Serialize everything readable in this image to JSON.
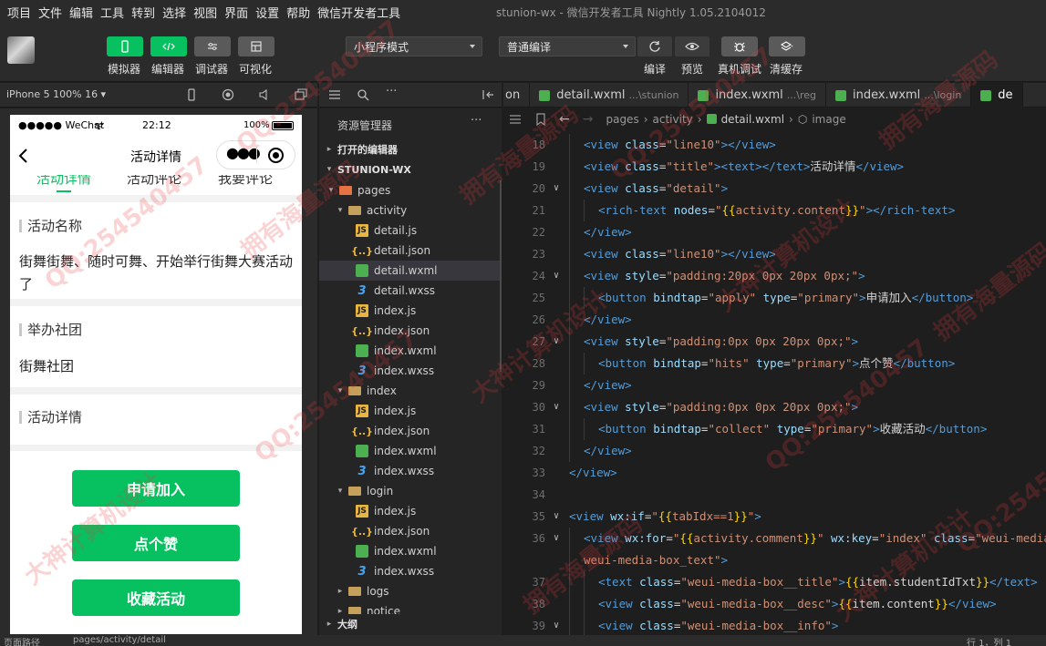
{
  "menu": [
    "项目",
    "文件",
    "编辑",
    "工具",
    "转到",
    "选择",
    "视图",
    "界面",
    "设置",
    "帮助",
    "微信开发者工具"
  ],
  "window_title": "stunion-wx - 微信开发者工具 Nightly 1.05.2104012",
  "toolbar": {
    "simulator": "模拟器",
    "editor": "编辑器",
    "debugger": "调试器",
    "visual": "可视化",
    "mode_select": "小程序模式",
    "compile_select": "普通编译",
    "compile": "编译",
    "preview": "预览",
    "remote_debug": "真机调试",
    "clear_cache": "清缓存"
  },
  "simulator_header": {
    "device": "iPhone 5 100% 16 ▾"
  },
  "phone": {
    "carrier": "●●●●● WeChat",
    "time": "22:12",
    "battery": "100%",
    "nav_title": "活动详情",
    "tabs": [
      "活动详情",
      "活动评论",
      "我要评论"
    ],
    "section1_title": "活动名称",
    "section1_text": "街舞街舞、随时可舞、开始举行街舞大赛活动了",
    "section2_title": "举办社团",
    "section2_text": "街舞社团",
    "section3_title": "活动详情",
    "buttons": [
      "申请加入",
      "点个赞",
      "收藏活动"
    ]
  },
  "explorer": {
    "title": "资源管理器",
    "open_editors": "打开的编辑器",
    "project": "STUNION-WX",
    "outline": "大纲",
    "tree": [
      {
        "label": "pages",
        "type": "folder-red",
        "arrow": "▾",
        "level": 1
      },
      {
        "label": "activity",
        "type": "folder",
        "arrow": "▾",
        "level": 2
      },
      {
        "label": "detail.js",
        "type": "js",
        "arrow": "",
        "level": 3
      },
      {
        "label": "detail.json",
        "type": "json",
        "arrow": "",
        "level": 3
      },
      {
        "label": "detail.wxml",
        "type": "wxml",
        "arrow": "",
        "level": 3,
        "selected": true
      },
      {
        "label": "detail.wxss",
        "type": "wxss",
        "arrow": "",
        "level": 3
      },
      {
        "label": "index.js",
        "type": "js",
        "arrow": "",
        "level": 3
      },
      {
        "label": "index.json",
        "type": "json",
        "arrow": "",
        "level": 3
      },
      {
        "label": "index.wxml",
        "type": "wxml",
        "arrow": "",
        "level": 3
      },
      {
        "label": "index.wxss",
        "type": "wxss",
        "arrow": "",
        "level": 3
      },
      {
        "label": "index",
        "type": "folder",
        "arrow": "▾",
        "level": 2
      },
      {
        "label": "index.js",
        "type": "js",
        "arrow": "",
        "level": 3
      },
      {
        "label": "index.json",
        "type": "json",
        "arrow": "",
        "level": 3
      },
      {
        "label": "index.wxml",
        "type": "wxml",
        "arrow": "",
        "level": 3
      },
      {
        "label": "index.wxss",
        "type": "wxss",
        "arrow": "",
        "level": 3
      },
      {
        "label": "login",
        "type": "folder",
        "arrow": "▾",
        "level": 2
      },
      {
        "label": "index.js",
        "type": "js",
        "arrow": "",
        "level": 3
      },
      {
        "label": "index.json",
        "type": "json",
        "arrow": "",
        "level": 3
      },
      {
        "label": "index.wxml",
        "type": "wxml",
        "arrow": "",
        "level": 3
      },
      {
        "label": "index.wxss",
        "type": "wxss",
        "arrow": "",
        "level": 3
      },
      {
        "label": "logs",
        "type": "folder",
        "arrow": "▸",
        "level": 2
      },
      {
        "label": "notice",
        "type": "folder",
        "arrow": "▸",
        "level": 2
      }
    ]
  },
  "editor_tabs": [
    {
      "name": "on",
      "path": "",
      "icon": false
    },
    {
      "name": "detail.wxml",
      "path": "...\\stunion",
      "icon": true
    },
    {
      "name": "index.wxml",
      "path": "...\\reg",
      "icon": true
    },
    {
      "name": "index.wxml",
      "path": "...\\login",
      "icon": true
    },
    {
      "name": "de",
      "path": "",
      "icon": true,
      "active": true
    }
  ],
  "breadcrumb": [
    "pages",
    "activity",
    "detail.wxml",
    "image"
  ],
  "code_lines": [
    {
      "n": "18",
      "fold": "",
      "indent": 1,
      "html": "<span class='t'>&lt;view</span> <span class='a'>class</span><span class='x'>=</span><span class='s'>\"line10\"</span><span class='t'>&gt;&lt;/view&gt;</span>"
    },
    {
      "n": "19",
      "fold": "",
      "indent": 1,
      "html": "<span class='t'>&lt;view</span> <span class='a'>class</span><span class='x'>=</span><span class='s'>\"title\"</span><span class='t'>&gt;&lt;text&gt;&lt;/text&gt;</span><span class='x'>活动详情</span><span class='t'>&lt;/view&gt;</span>"
    },
    {
      "n": "20",
      "fold": "∨",
      "indent": 1,
      "html": "<span class='t'>&lt;view</span> <span class='a'>class</span><span class='x'>=</span><span class='s'>\"detail\"</span><span class='t'>&gt;</span>"
    },
    {
      "n": "21",
      "fold": "",
      "indent": 2,
      "html": "<span class='t'>&lt;rich-text</span> <span class='a'>nodes</span><span class='x'>=</span><span class='s'>\"</span><span class='b'>{{</span><span class='s'>activity.content</span><span class='b'>}}</span><span class='s'>\"</span><span class='t'>&gt;&lt;/rich-text&gt;</span>"
    },
    {
      "n": "22",
      "fold": "",
      "indent": 1,
      "html": "<span class='t'>&lt;/view&gt;</span>"
    },
    {
      "n": "23",
      "fold": "",
      "indent": 1,
      "html": "<span class='t'>&lt;view</span> <span class='a'>class</span><span class='x'>=</span><span class='s'>\"line10\"</span><span class='t'>&gt;&lt;/view&gt;</span>"
    },
    {
      "n": "24",
      "fold": "∨",
      "indent": 1,
      "html": "<span class='t'>&lt;view</span> <span class='a'>style</span><span class='x'>=</span><span class='s'>\"padding:20px 0px 20px 0px;\"</span><span class='t'>&gt;</span>"
    },
    {
      "n": "25",
      "fold": "",
      "indent": 2,
      "html": "<span class='t'>&lt;button</span> <span class='a'>bindtap</span><span class='x'>=</span><span class='s'>\"apply\"</span> <span class='a'>type</span><span class='x'>=</span><span class='s'>\"primary\"</span><span class='t'>&gt;</span><span class='x'>申请加入</span><span class='t'>&lt;/button&gt;</span>"
    },
    {
      "n": "26",
      "fold": "",
      "indent": 1,
      "html": "<span class='t'>&lt;/view&gt;</span>"
    },
    {
      "n": "27",
      "fold": "∨",
      "indent": 1,
      "html": "<span class='t'>&lt;view</span> <span class='a'>style</span><span class='x'>=</span><span class='s'>\"padding:0px 0px 20px 0px;\"</span><span class='t'>&gt;</span>"
    },
    {
      "n": "28",
      "fold": "",
      "indent": 2,
      "html": "<span class='t'>&lt;button</span> <span class='a'>bindtap</span><span class='x'>=</span><span class='s'>\"hits\"</span> <span class='a'>type</span><span class='x'>=</span><span class='s'>\"primary\"</span><span class='t'>&gt;</span><span class='x'>点个赞</span><span class='t'>&lt;/button&gt;</span>"
    },
    {
      "n": "29",
      "fold": "",
      "indent": 1,
      "html": "<span class='t'>&lt;/view&gt;</span>"
    },
    {
      "n": "30",
      "fold": "∨",
      "indent": 1,
      "html": "<span class='t'>&lt;view</span> <span class='a'>style</span><span class='x'>=</span><span class='s'>\"padding:0px 0px 20px 0px;\"</span><span class='t'>&gt;</span>"
    },
    {
      "n": "31",
      "fold": "",
      "indent": 2,
      "html": "<span class='t'>&lt;button</span> <span class='a'>bindtap</span><span class='x'>=</span><span class='s'>\"collect\"</span> <span class='a'>type</span><span class='x'>=</span><span class='s'>\"primary\"</span><span class='t'>&gt;</span><span class='x'>收藏活动</span><span class='t'>&lt;/button&gt;</span>"
    },
    {
      "n": "32",
      "fold": "",
      "indent": 1,
      "html": "<span class='t'>&lt;/view&gt;</span>"
    },
    {
      "n": "33",
      "fold": "",
      "indent": 0,
      "html": "<span class='t'>&lt;/view&gt;</span>"
    },
    {
      "n": "34",
      "fold": "",
      "indent": 0,
      "html": ""
    },
    {
      "n": "35",
      "fold": "∨",
      "indent": 0,
      "html": "<span class='t'>&lt;view</span> <span class='a'>wx:if</span><span class='x'>=</span><span class='s'>\"</span><span class='b'>{{</span><span class='s'>tabIdx==1</span><span class='b'>}}</span><span class='s'>\"</span><span class='t'>&gt;</span>"
    },
    {
      "n": "36",
      "fold": "∨",
      "indent": 1,
      "html": "<span class='t'>&lt;view</span> <span class='a'>wx:for</span><span class='x'>=</span><span class='s'>\"</span><span class='b'>{{</span><span class='s'>activity.comment</span><span class='b'>}}</span><span class='s'>\"</span> <span class='a'>wx:key</span><span class='x'>=</span><span class='s'>\"index\"</span> <span class='a'>class</span><span class='x'>=</span><span class='s'>\"weui-media-box weui-media-box_text\"</span><span class='t'>&gt;</span>"
    },
    {
      "n": "",
      "fold": "",
      "indent": 1,
      "html": "<span class='s'>weui-media-box_text\"</span><span class='t'>&gt;</span>"
    },
    {
      "n": "37",
      "fold": "",
      "indent": 2,
      "html": "<span class='t'>&lt;text</span> <span class='a'>class</span><span class='x'>=</span><span class='s'>\"weui-media-box__title\"</span><span class='t'>&gt;</span><span class='b'>{{</span><span class='x'>item.studentIdTxt</span><span class='b'>}}</span><span class='t'>&lt;/text&gt;</span>"
    },
    {
      "n": "38",
      "fold": "",
      "indent": 2,
      "html": "<span class='t'>&lt;view</span> <span class='a'>class</span><span class='x'>=</span><span class='s'>\"weui-media-box__desc\"</span><span class='t'>&gt;</span><span class='b'>{{</span><span class='x'>item.content</span><span class='b'>}}</span><span class='t'>&lt;/view&gt;</span>"
    },
    {
      "n": "39",
      "fold": "∨",
      "indent": 2,
      "html": "<span class='t'>&lt;view</span> <span class='a'>class</span><span class='x'>=</span><span class='s'>\"weui-media-box__info\"</span><span class='t'>&gt;</span>"
    }
  ],
  "status_bar": {
    "left": "页面路径",
    "path": "pages/activity/detail",
    "right": "行 1，列 1"
  },
  "watermark": [
    "QQ:254540457",
    "拥有海量源码",
    "大神计算机设计"
  ]
}
